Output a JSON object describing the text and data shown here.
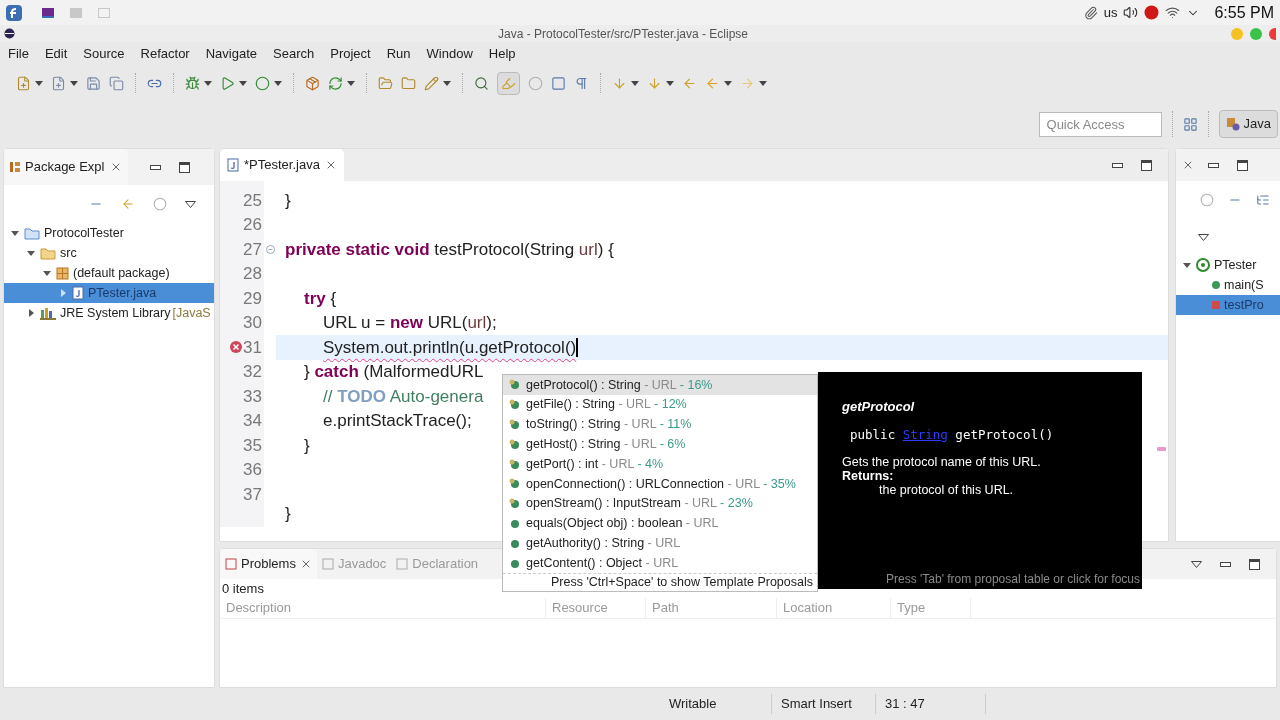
{
  "system_bar": {
    "keyboard": "us",
    "clock": "6:55 PM"
  },
  "window": {
    "title": "Java - ProtocolTester/src/PTester.java - Eclipse"
  },
  "menu": [
    "File",
    "Edit",
    "Source",
    "Refactor",
    "Navigate",
    "Search",
    "Project",
    "Run",
    "Window",
    "Help"
  ],
  "quick_access": {
    "placeholder": "Quick Access"
  },
  "perspectives": [
    {
      "label": "Java",
      "selected": true
    }
  ],
  "package_explorer": {
    "title": "Package Expl",
    "tree": [
      {
        "label": "ProtocolTester",
        "kind": "project",
        "expanded": true,
        "selected": false,
        "children": [
          {
            "label": "src",
            "kind": "source-folder",
            "expanded": true,
            "selected": false,
            "children": [
              {
                "label": "(default package)",
                "kind": "package",
                "expanded": true,
                "selected": false,
                "children": [
                  {
                    "label": "PTester.java",
                    "kind": "java-file",
                    "expanded": false,
                    "selected": true
                  }
                ]
              }
            ]
          },
          {
            "label": "JRE System Library",
            "decoration": "[JavaS",
            "kind": "library",
            "expanded": false,
            "selected": false
          }
        ]
      }
    ]
  },
  "editor": {
    "tabs": [
      {
        "label": "*PTester.java",
        "selected": true
      }
    ],
    "lines": [
      {
        "number": "25",
        "segments": [
          {
            "kind": "plain",
            "text": "}"
          }
        ]
      },
      {
        "number": "26"
      },
      {
        "number": "27",
        "foldable": true,
        "segments": [
          {
            "kind": "keyword",
            "text": "private static void"
          },
          {
            "kind": "plain",
            "text": " testProtocol(String "
          },
          {
            "kind": "param",
            "text": "url"
          },
          {
            "kind": "plain",
            "text": ") {"
          }
        ],
        "children": [
          {
            "number": "28"
          },
          {
            "number": "29",
            "segments": [
              {
                "kind": "keyword",
                "text": "try"
              },
              {
                "kind": "plain",
                "text": " {"
              }
            ],
            "children": [
              {
                "number": "30",
                "segments": [
                  {
                    "kind": "plain",
                    "text": "URL u = "
                  },
                  {
                    "kind": "keyword",
                    "text": "new"
                  },
                  {
                    "kind": "plain",
                    "text": " URL("
                  },
                  {
                    "kind": "param",
                    "text": "url"
                  },
                  {
                    "kind": "plain",
                    "text": ");"
                  }
                ]
              },
              {
                "number": "31",
                "current": true,
                "error": true,
                "segments": [
                  {
                    "kind": "error",
                    "text": "System.out.println(u.getProtocol()"
                  }
                ]
              }
            ]
          },
          {
            "number": "32",
            "segments": [
              {
                "kind": "plain",
                "text": "} "
              },
              {
                "kind": "keyword",
                "text": "catch"
              },
              {
                "kind": "plain",
                "text": " (MalformedURL"
              }
            ],
            "children": [
              {
                "number": "33",
                "segments": [
                  {
                    "kind": "comment",
                    "text": "// "
                  },
                  {
                    "kind": "task",
                    "text": "TODO"
                  },
                  {
                    "kind": "comment",
                    "text": " Auto-genera"
                  }
                ]
              },
              {
                "number": "34",
                "segments": [
                  {
                    "kind": "plain",
                    "text": "e.printStackTrace();"
                  }
                ]
              }
            ]
          },
          {
            "number": "35",
            "segments": [
              {
                "kind": "plain",
                "text": "}"
              }
            ]
          },
          {
            "number": "36"
          },
          {
            "number": "37"
          }
        ]
      }
    ],
    "closing_brace": "}"
  },
  "completion": {
    "items": [
      {
        "signature": "getProtocol() : String",
        "owner": "- URL",
        "relevance": "- 16%",
        "selected": true
      },
      {
        "signature": "getFile() : String",
        "owner": "- URL",
        "relevance": "- 12%",
        "selected": false
      },
      {
        "signature": "toString() : String",
        "owner": "- URL",
        "relevance": "- 11%",
        "selected": false
      },
      {
        "signature": "getHost() : String",
        "owner": "- URL",
        "relevance": "- 6%",
        "selected": false
      },
      {
        "signature": "getPort() : int",
        "owner": "- URL",
        "relevance": "- 4%",
        "selected": false
      },
      {
        "signature": "openConnection() : URLConnection",
        "owner": "- URL",
        "relevance": "- 35%",
        "selected": false
      },
      {
        "signature": "openStream() : InputStream",
        "owner": "- URL",
        "relevance": "- 23%",
        "selected": false
      },
      {
        "signature": "equals(Object obj) : boolean",
        "owner": "- URL",
        "selected": false
      },
      {
        "signature": "getAuthority() : String",
        "owner": "- URL",
        "selected": false
      },
      {
        "signature": "getContent() : Object",
        "owner": "- URL",
        "selected": false
      }
    ],
    "footer": "Press 'Ctrl+Space' to show Template Proposals"
  },
  "javadoc": {
    "title": "getProtocol",
    "signature_prefix": "public ",
    "signature_link": "String",
    "signature_suffix": " getProtocol()",
    "description": "Gets the protocol name of this URL.",
    "returns_label": "Returns:",
    "returns": "the protocol of this URL.",
    "footer": "Press 'Tab' from proposal table or click for focus"
  },
  "outline": {
    "tree": [
      {
        "label": "PTester",
        "kind": "class",
        "expanded": true,
        "selected": false,
        "children": [
          {
            "label": "main(S",
            "kind": "public-method",
            "selected": false
          },
          {
            "label": "testPro",
            "kind": "private-method",
            "selected": true
          }
        ]
      }
    ]
  },
  "problems": {
    "tabs": [
      {
        "label": "Problems",
        "selected": true
      },
      {
        "label": "Javadoc",
        "selected": false
      },
      {
        "label": "Declaration",
        "selected": false
      }
    ],
    "summary": "0 items",
    "columns": [
      "Description",
      "Resource",
      "Path",
      "Location",
      "Type"
    ]
  },
  "status_bar": [
    "Writable",
    "Smart Insert",
    "31 : 47"
  ]
}
